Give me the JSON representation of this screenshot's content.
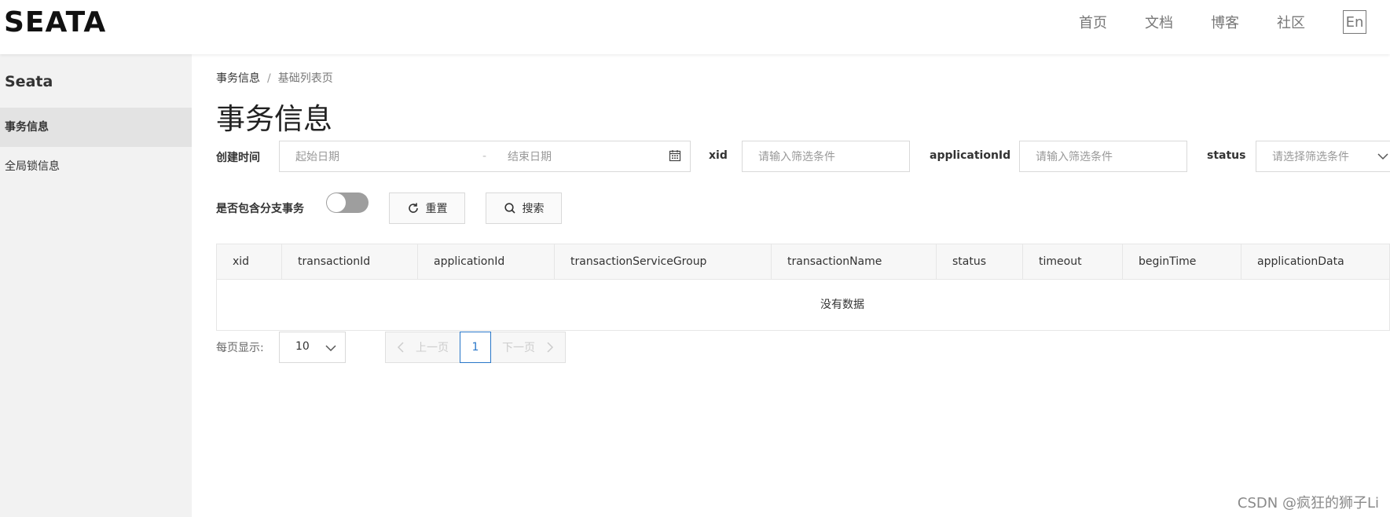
{
  "header": {
    "logo_text": "SEATA",
    "nav": [
      "首页",
      "文档",
      "博客",
      "社区"
    ],
    "lang": "En"
  },
  "sidebar": {
    "title": "Seata",
    "items": [
      {
        "label": "事务信息",
        "active": true
      },
      {
        "label": "全局锁信息",
        "active": false
      }
    ]
  },
  "breadcrumb": {
    "current": "事务信息",
    "separator": "/",
    "sub": "基础列表页"
  },
  "page_title": "事务信息",
  "filters": {
    "created_time_label": "创建时间",
    "start_placeholder": "起始日期",
    "range_sep": "-",
    "end_placeholder": "结束日期",
    "xid_label": "xid",
    "xid_placeholder": "请输入筛选条件",
    "appid_label": "applicationId",
    "appid_placeholder": "请输入筛选条件",
    "status_label": "status",
    "status_placeholder": "请选择筛选条件",
    "branch_label": "是否包含分支事务",
    "branch_toggle_on": false,
    "reset_label": "重置",
    "search_label": "搜索"
  },
  "table": {
    "columns": [
      "xid",
      "transactionId",
      "applicationId",
      "transactionServiceGroup",
      "transactionName",
      "status",
      "timeout",
      "beginTime",
      "applicationData"
    ],
    "empty_text": "没有数据"
  },
  "pagination": {
    "page_size_label": "每页显示:",
    "page_size": "10",
    "prev_label": "上一页",
    "current_page": "1",
    "next_label": "下一页"
  },
  "watermark": "CSDN @疯狂的狮子Li"
}
